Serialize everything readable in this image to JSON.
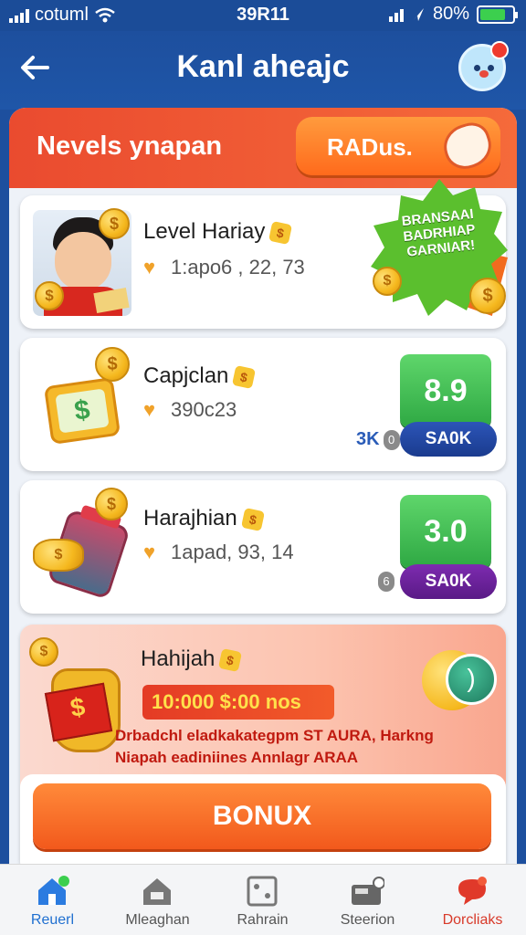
{
  "status_bar": {
    "carrier": "cotuml",
    "time": "39R11",
    "battery": "80%",
    "battery_level": 0.8
  },
  "header": {
    "title": "Kanl aheajc"
  },
  "section": {
    "title": "Nevels ynapan",
    "action_label": "RADus."
  },
  "promo_badge": {
    "text": "BRANSAAI BADRHIAP GARNIAR!"
  },
  "cards": [
    {
      "name": "Level Hariay",
      "meta": "1:apo6 , 22, 73",
      "stamp": ""
    },
    {
      "name": "Capjclan",
      "meta": "390c23",
      "score": "8.9",
      "sub_label": "3K",
      "button": "SA0K"
    },
    {
      "name": "Harajhian",
      "meta": "1apad, 93, 14",
      "score": "3.0",
      "button": "SA0K"
    }
  ],
  "bonus": {
    "title": "Hahijah",
    "amount": "10:000 $:00 nos",
    "desc_line1": "Drbadchl eladkakategpm ST AURA, Harkng",
    "desc_line2": "Niapah eadiniines Annlagr ARAA",
    "button_label": "BONUX"
  },
  "tabs": [
    {
      "label": "Reuerl",
      "icon": "house-icon"
    },
    {
      "label": "Mleaghan",
      "icon": "home-icon"
    },
    {
      "label": "Rahrain",
      "icon": "dice-icon"
    },
    {
      "label": "Steerion",
      "icon": "wallet-icon"
    },
    {
      "label": "Dorcliaks",
      "icon": "chat-icon"
    }
  ],
  "colors": {
    "brand_blue": "#1d4f9e",
    "accent_orange": "#f2591c",
    "green": "#2ea843"
  }
}
